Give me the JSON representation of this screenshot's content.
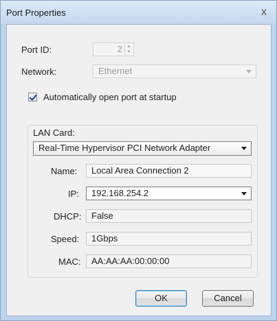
{
  "dialog": {
    "title": "Port Properties",
    "close_glyph": "x"
  },
  "form": {
    "port_id_label": "Port ID:",
    "port_id_value": "2",
    "network_label": "Network:",
    "network_value": "Ethernet",
    "autostart_label": "Automatically open port at startup",
    "autostart_checked": true
  },
  "lan_card": {
    "group_label": "LAN Card:",
    "adapter_value": "Real-Time Hypervisor PCI Network Adapter",
    "name_label": "Name:",
    "name_value": "Local Area Connection 2",
    "ip_label": "IP:",
    "ip_value": "192.168.254.2",
    "dhcp_label": "DHCP:",
    "dhcp_value": "False",
    "speed_label": "Speed:",
    "speed_value": "1Gbps",
    "mac_label": "MAC:",
    "mac_value": "AA:AA:AA:00:00:00"
  },
  "buttons": {
    "ok_label": "OK",
    "cancel_label": "Cancel"
  }
}
